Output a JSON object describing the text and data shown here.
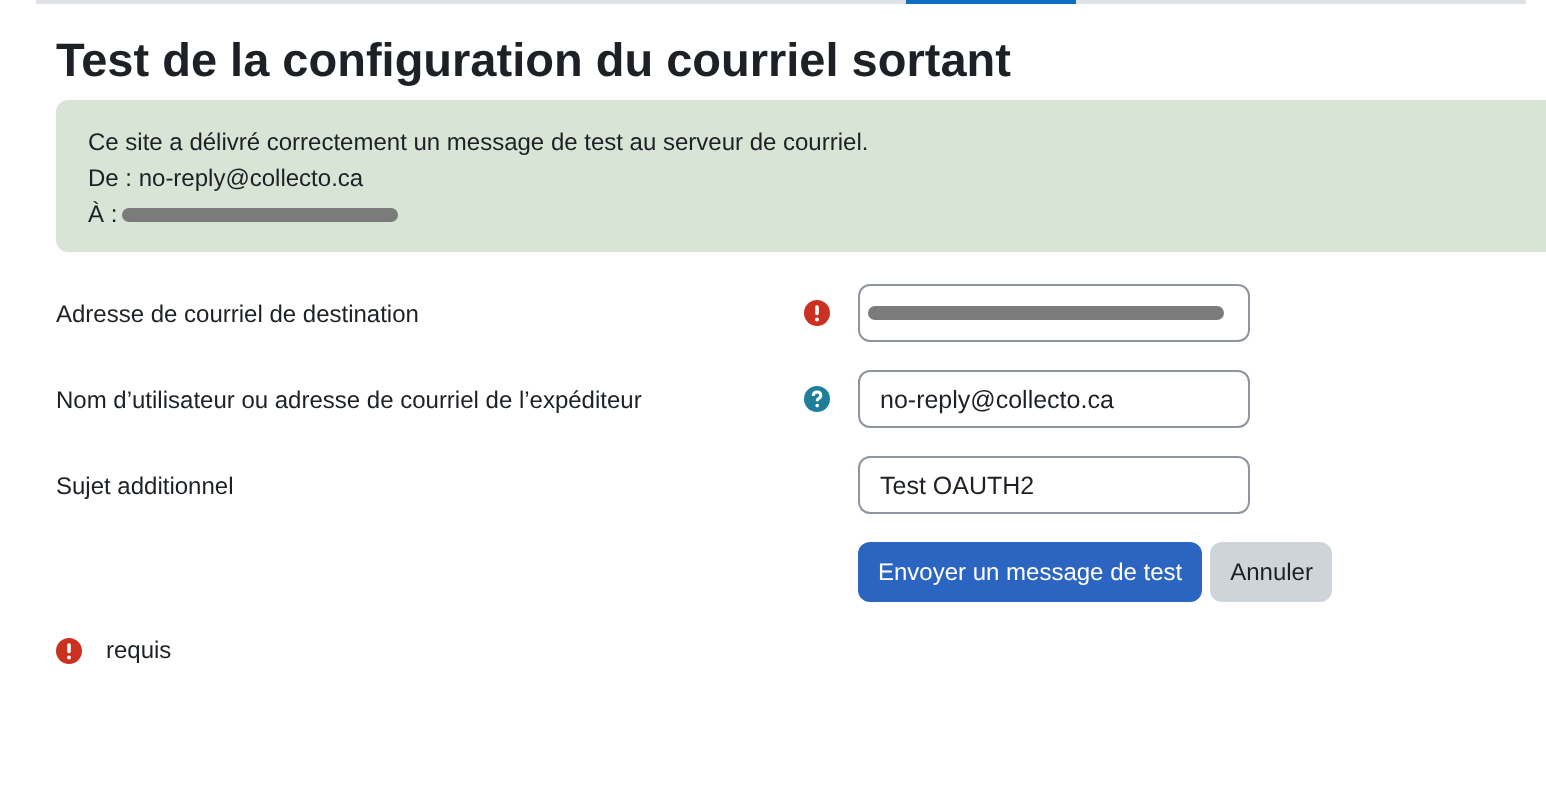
{
  "title": "Test de la configuration du courriel sortant",
  "alert": {
    "lines": [
      {
        "text": "Ce site a délivré correctement un message de test au serveur de courriel.",
        "redacted": false
      },
      {
        "text": "De : no-reply@collecto.ca",
        "redacted": false
      },
      {
        "text": "À :",
        "redacted": true
      }
    ]
  },
  "fields": [
    {
      "label": "Adresse de courriel de destination",
      "kind": "required",
      "redacted": true
    },
    {
      "label": "Nom d’utilisateur ou adresse de courriel de l’expéditeur",
      "kind": "help",
      "value": "no-reply@collecto.ca",
      "redacted": false
    },
    {
      "label": "Sujet additionnel",
      "kind": "plain",
      "value": "Test OAUTH2",
      "redacted": false
    }
  ],
  "buttons": [
    {
      "label": "Envoyer un message de test",
      "kind": "primary"
    },
    {
      "label": "Annuler",
      "kind": "secondary"
    }
  ],
  "legend": {
    "kind": "required",
    "text": "requis"
  }
}
